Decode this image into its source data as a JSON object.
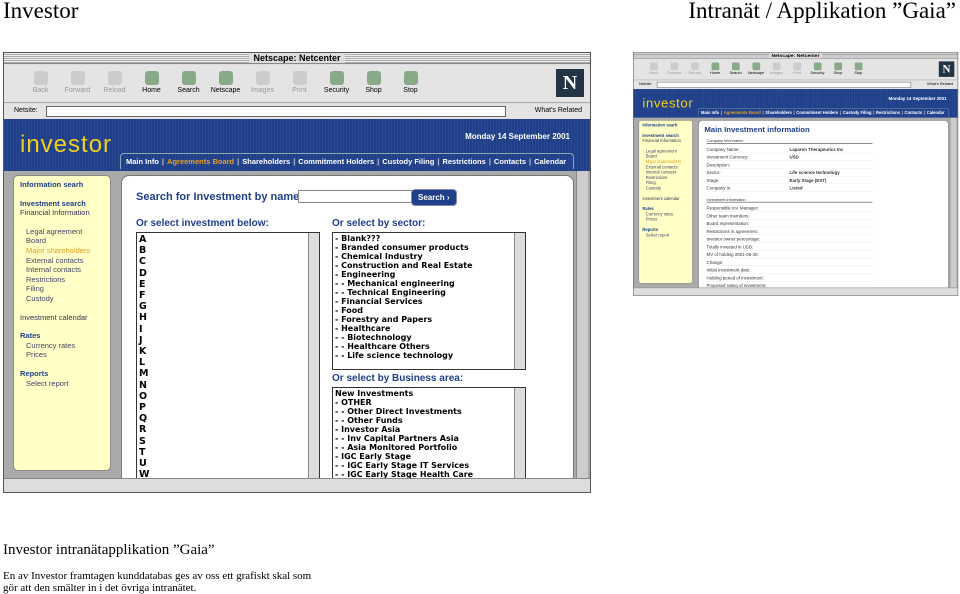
{
  "slide": {
    "title_left": "Investor",
    "title_right": "Intranät / Applikation ”Gaia”",
    "caption_title": "Investor intranätapplikation ”Gaia”",
    "caption_text": "En av Investor framtagen kunddatabas ges av oss ett grafiskt skal som gör att den smälter in i det övriga intranätet."
  },
  "browser": {
    "title": "Netscape: Netcenter",
    "toolbar": [
      {
        "label": "Back",
        "enabled": false
      },
      {
        "label": "Forward",
        "enabled": false
      },
      {
        "label": "Reload",
        "enabled": false
      },
      {
        "label": "Home",
        "enabled": true
      },
      {
        "label": "Search",
        "enabled": true
      },
      {
        "label": "Netscape",
        "enabled": true
      },
      {
        "label": "Images",
        "enabled": false
      },
      {
        "label": "Print",
        "enabled": false
      },
      {
        "label": "Security",
        "enabled": true
      },
      {
        "label": "Shop",
        "enabled": true
      },
      {
        "label": "Stop",
        "enabled": true
      }
    ],
    "netsite_label": "Netsite:",
    "url": "",
    "whats_related": "What's Related"
  },
  "app": {
    "logo": "investor",
    "date": "Monday 14 September 2001",
    "nav": [
      "Main Info",
      "Agreements Board",
      "Shareholders",
      "Commitment Holders",
      "Custody Filing",
      "Restrictions",
      "Contacts",
      "Calendar"
    ],
    "active_nav": "Agreements Board",
    "accent": "#1f3f8a",
    "highlight": "#e0a020",
    "sidebar": {
      "info_search": "Information searh",
      "inv_search": "Investment search",
      "financial": "Financial Information",
      "items": [
        "Legal agreement",
        "Board",
        "Major shareholders",
        "External contacts",
        "Internal contacts",
        "Restrictions",
        "Filing",
        "Custody"
      ],
      "highlighted": "Major shareholders",
      "calendar": "Investment calendar",
      "rates": "Rates",
      "rates_items": [
        "Currency rates",
        "Prices"
      ],
      "reports": "Reports",
      "reports_items": [
        "Select report"
      ]
    }
  },
  "search": {
    "label": "Search for Investment by name:",
    "value": "",
    "button": "Search ›",
    "select_below": "Or select investment below:",
    "letters": [
      "A",
      "B",
      "C",
      "D",
      "E",
      "F",
      "G",
      "H",
      "I",
      "J",
      "K",
      "L",
      "M",
      "N",
      "O",
      "P",
      "Q",
      "R",
      "S",
      "T",
      "U",
      "W"
    ],
    "sector_label": "Or select by sector:",
    "sectors": [
      "- Blank???",
      "- Branded consumer products",
      "- Chemical Industry",
      "- Construction and Real Estate",
      "- Engineering",
      "-  - Mechanical engineering",
      "-  - Technical Engineering",
      "- Financial Services",
      "- Food",
      "- Forestry and Papers",
      "- Healthcare",
      "-  - Biotechnology",
      "-  - Healthcare Others",
      "-  - Life science technology"
    ],
    "business_label": "Or select by Business area:",
    "business": [
      "New Investments",
      " - OTHER",
      "-  - Other Direct Investments",
      "-  - Other Funds",
      "- Investor Asia",
      "-  - Inv Capital Partners Asia",
      "-  - Asia Monitored Portfolio",
      "- IGC Early Stage",
      "-  - IGC Early Stage IT Services",
      "-  - IGC Early Stage Health Care"
    ]
  },
  "detail": {
    "title": "Main Investment information",
    "company_section": "Company information",
    "company_rows": [
      {
        "label": "Company Name:",
        "value": "Laparon Therapeutics Inc"
      },
      {
        "label": "Investment Currency:",
        "value": "USD"
      },
      {
        "label": "Description:",
        "value": ""
      },
      {
        "label": "Sector:",
        "value": "Life science technology"
      },
      {
        "label": "Stage:",
        "value": "Early Stage (EST)"
      },
      {
        "label": "Company is:",
        "value": "Listed"
      }
    ],
    "investment_section": "Investment information",
    "investment_rows": [
      "Responsible inv. Manager:",
      "Other team members:",
      "Board representation:",
      "Restrictions in agreement:",
      "Investor owner percentage:",
      "Totally invested in USD:",
      "MV of holding 2001-09-30:",
      "Change:",
      "Initial investment date:",
      "Holding period of investment:",
      "Proposed rating of investment:"
    ]
  }
}
